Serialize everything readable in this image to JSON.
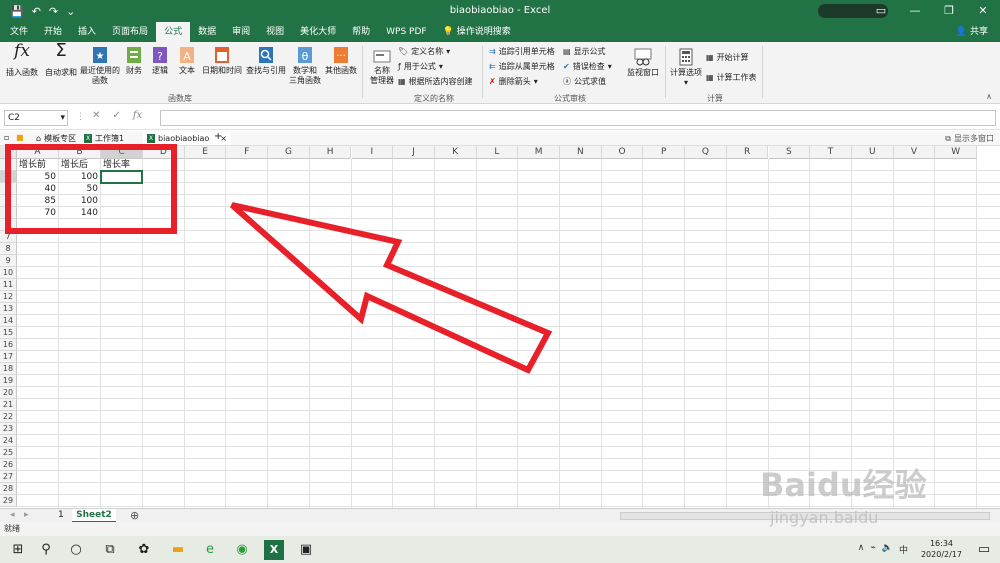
{
  "window": {
    "title": "biaobiaobiao - Excel"
  },
  "ribbon_tabs": [
    "文件",
    "开始",
    "插入",
    "页面布局",
    "公式",
    "数据",
    "审阅",
    "视图",
    "美化大师",
    "帮助",
    "WPS PDF"
  ],
  "tell_me": "操作说明搜索",
  "share": "共享",
  "ribbon": {
    "insert_function": "插入函数",
    "autosum": "自动求和",
    "recent_line1": "最近使用的",
    "recent_line2": "函数",
    "financial": "财务",
    "logical": "逻辑",
    "text": "文本",
    "datetime": "日期和时间",
    "lookup": "查找与引用",
    "math_line1": "数学和",
    "math_line2": "三角函数",
    "other": "其他函数",
    "group_library": "函数库",
    "name_manager_line1": "名称",
    "name_manager_line2": "管理器",
    "define_name": "定义名称",
    "use_in_formula": "用于公式",
    "create_from_selection": "根据所选内容创建",
    "group_names": "定义的名称",
    "trace_precedents": "追踪引用单元格",
    "trace_dependents": "追踪从属单元格",
    "remove_arrows": "删除箭头",
    "show_formulas": "显示公式",
    "error_checking": "错误检查",
    "evaluate_formula": "公式求值",
    "group_auditing": "公式审核",
    "watch_window": "监视窗口",
    "calc_options": "计算选项",
    "calc_now": "开始计算",
    "calc_sheet": "计算工作表",
    "group_calc": "计算"
  },
  "formula_bar": {
    "name_box": "C2",
    "fx": "fx"
  },
  "workbook_tabs": [
    "模板专区",
    "工作簿1",
    "biaobiaobiao"
  ],
  "show_multi_window": "显示多窗口",
  "columns": [
    "A",
    "B",
    "C",
    "D",
    "E",
    "F",
    "G",
    "H",
    "I",
    "J",
    "K",
    "L",
    "M",
    "N",
    "O",
    "P",
    "Q",
    "R",
    "S",
    "T",
    "U",
    "V",
    "W"
  ],
  "rows": [
    "1",
    "2",
    "3",
    "4",
    "5",
    "6",
    "7",
    "8",
    "9",
    "10",
    "11",
    "12",
    "13",
    "14",
    "15",
    "16",
    "17",
    "18",
    "19",
    "20",
    "21",
    "22",
    "23",
    "24",
    "25",
    "26",
    "27",
    "28",
    "29"
  ],
  "cells": {
    "A1": "增长前",
    "B1": "增长后",
    "C1": "增长率",
    "A2": "50",
    "B2": "100",
    "A3": "40",
    "B3": "50",
    "A4": "85",
    "B4": "100",
    "A5": "70",
    "B5": "140"
  },
  "sheet_tabs": [
    "1",
    "Sheet2"
  ],
  "status": "就绪",
  "clock": {
    "time": "16:34",
    "date": "2020/2/17"
  },
  "watermark": {
    "main": "Baidu经验",
    "sub": "jingyan.baidu"
  },
  "colors": {
    "excel_green": "#217346",
    "annotation_red": "#e8202a"
  }
}
